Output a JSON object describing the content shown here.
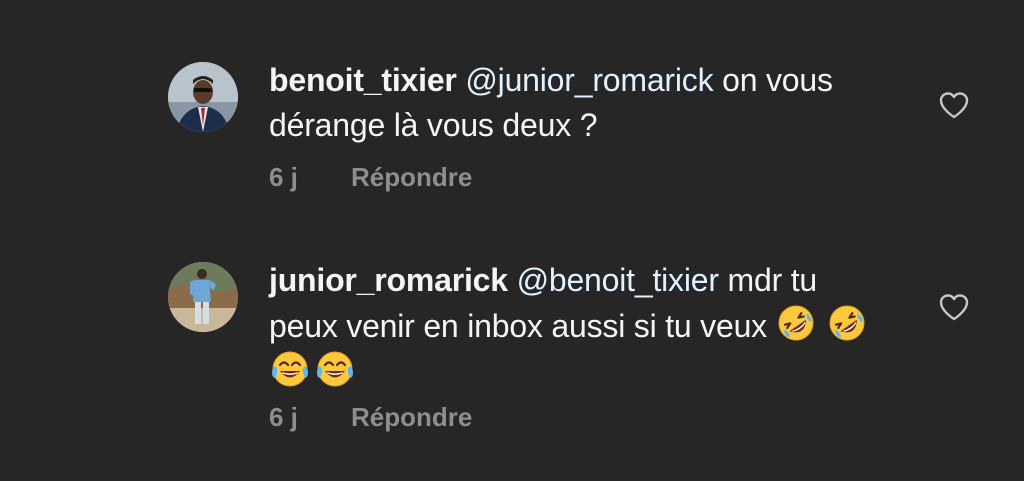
{
  "comments": [
    {
      "username": "benoit_tixier",
      "mention": "@junior_romarick",
      "text": "on vous dérange là vous deux ?",
      "time": "6 j",
      "reply_label": "Répondre"
    },
    {
      "username": "junior_romarick",
      "mention": "@benoit_tixier",
      "text": "mdr tu peux venir en inbox aussi si tu veux",
      "emojis": [
        "rolling-on-floor-laughing",
        "rolling-on-floor-laughing",
        "face-with-tears-of-joy",
        "face-with-tears-of-joy"
      ],
      "time": "6 j",
      "reply_label": "Répondre"
    }
  ],
  "icons": {
    "like": "heart-outline-icon"
  },
  "colors": {
    "background": "#262626",
    "text": "#f5f5f5",
    "mention": "#e0f1ff",
    "meta": "#8e8e8e",
    "emoji_face": "#ffc83d"
  }
}
